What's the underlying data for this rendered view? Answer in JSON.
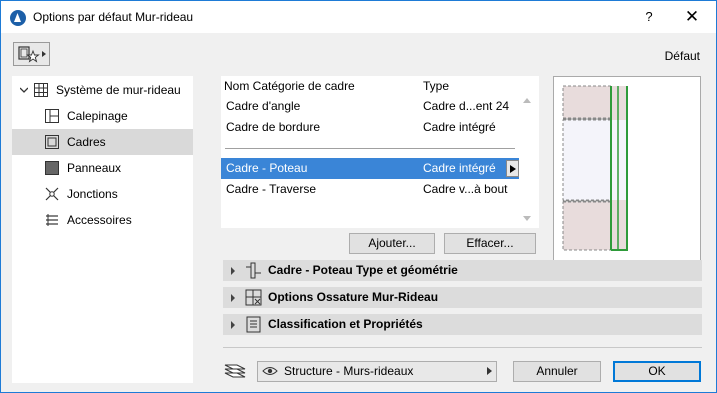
{
  "window": {
    "title": "Options par défaut Mur-rideau",
    "help_label": "?",
    "close_label": "✕"
  },
  "header": {
    "default_label": "Défaut",
    "favorites_icon": "favorites-icon"
  },
  "tree": {
    "root": {
      "label": "Système de mur-rideau",
      "icon": "curtain-wall-system-icon"
    },
    "items": [
      {
        "label": "Calepinage",
        "icon": "scheme-icon"
      },
      {
        "label": "Cadres",
        "icon": "frame-icon",
        "selected": true
      },
      {
        "label": "Panneaux",
        "icon": "panel-icon"
      },
      {
        "label": "Jonctions",
        "icon": "junction-icon"
      },
      {
        "label": "Accessoires",
        "icon": "accessory-icon"
      }
    ]
  },
  "frame_list": {
    "headers": {
      "name": "Nom Catégorie de cadre",
      "type": "Type"
    },
    "rows_top": [
      {
        "name": "Cadre d'angle",
        "type": "Cadre d...ent 24"
      },
      {
        "name": "Cadre de bordure",
        "type": "Cadre intégré"
      }
    ],
    "rows_bottom": [
      {
        "name": "Cadre - Poteau",
        "type": "Cadre intégré",
        "selected": true
      },
      {
        "name": "Cadre - Traverse",
        "type": "Cadre v...à bout"
      }
    ]
  },
  "buttons": {
    "add": "Ajouter...",
    "delete": "Effacer...",
    "cancel": "Annuler",
    "ok": "OK"
  },
  "sections": [
    {
      "label": "Cadre - Poteau Type et géométrie",
      "icon": "frame-geometry-icon"
    },
    {
      "label": "Options Ossature Mur-Rideau",
      "icon": "framing-options-icon"
    },
    {
      "label": "Classification et Propriétés",
      "icon": "classification-icon"
    }
  ],
  "footer": {
    "layer_icon": "layers-icon",
    "layer_value": "Structure - Murs-rideaux"
  },
  "colors": {
    "selection": "#3a85d7",
    "frame_green": "#2e9b3a",
    "panel_fill": "#e8dcdc"
  }
}
